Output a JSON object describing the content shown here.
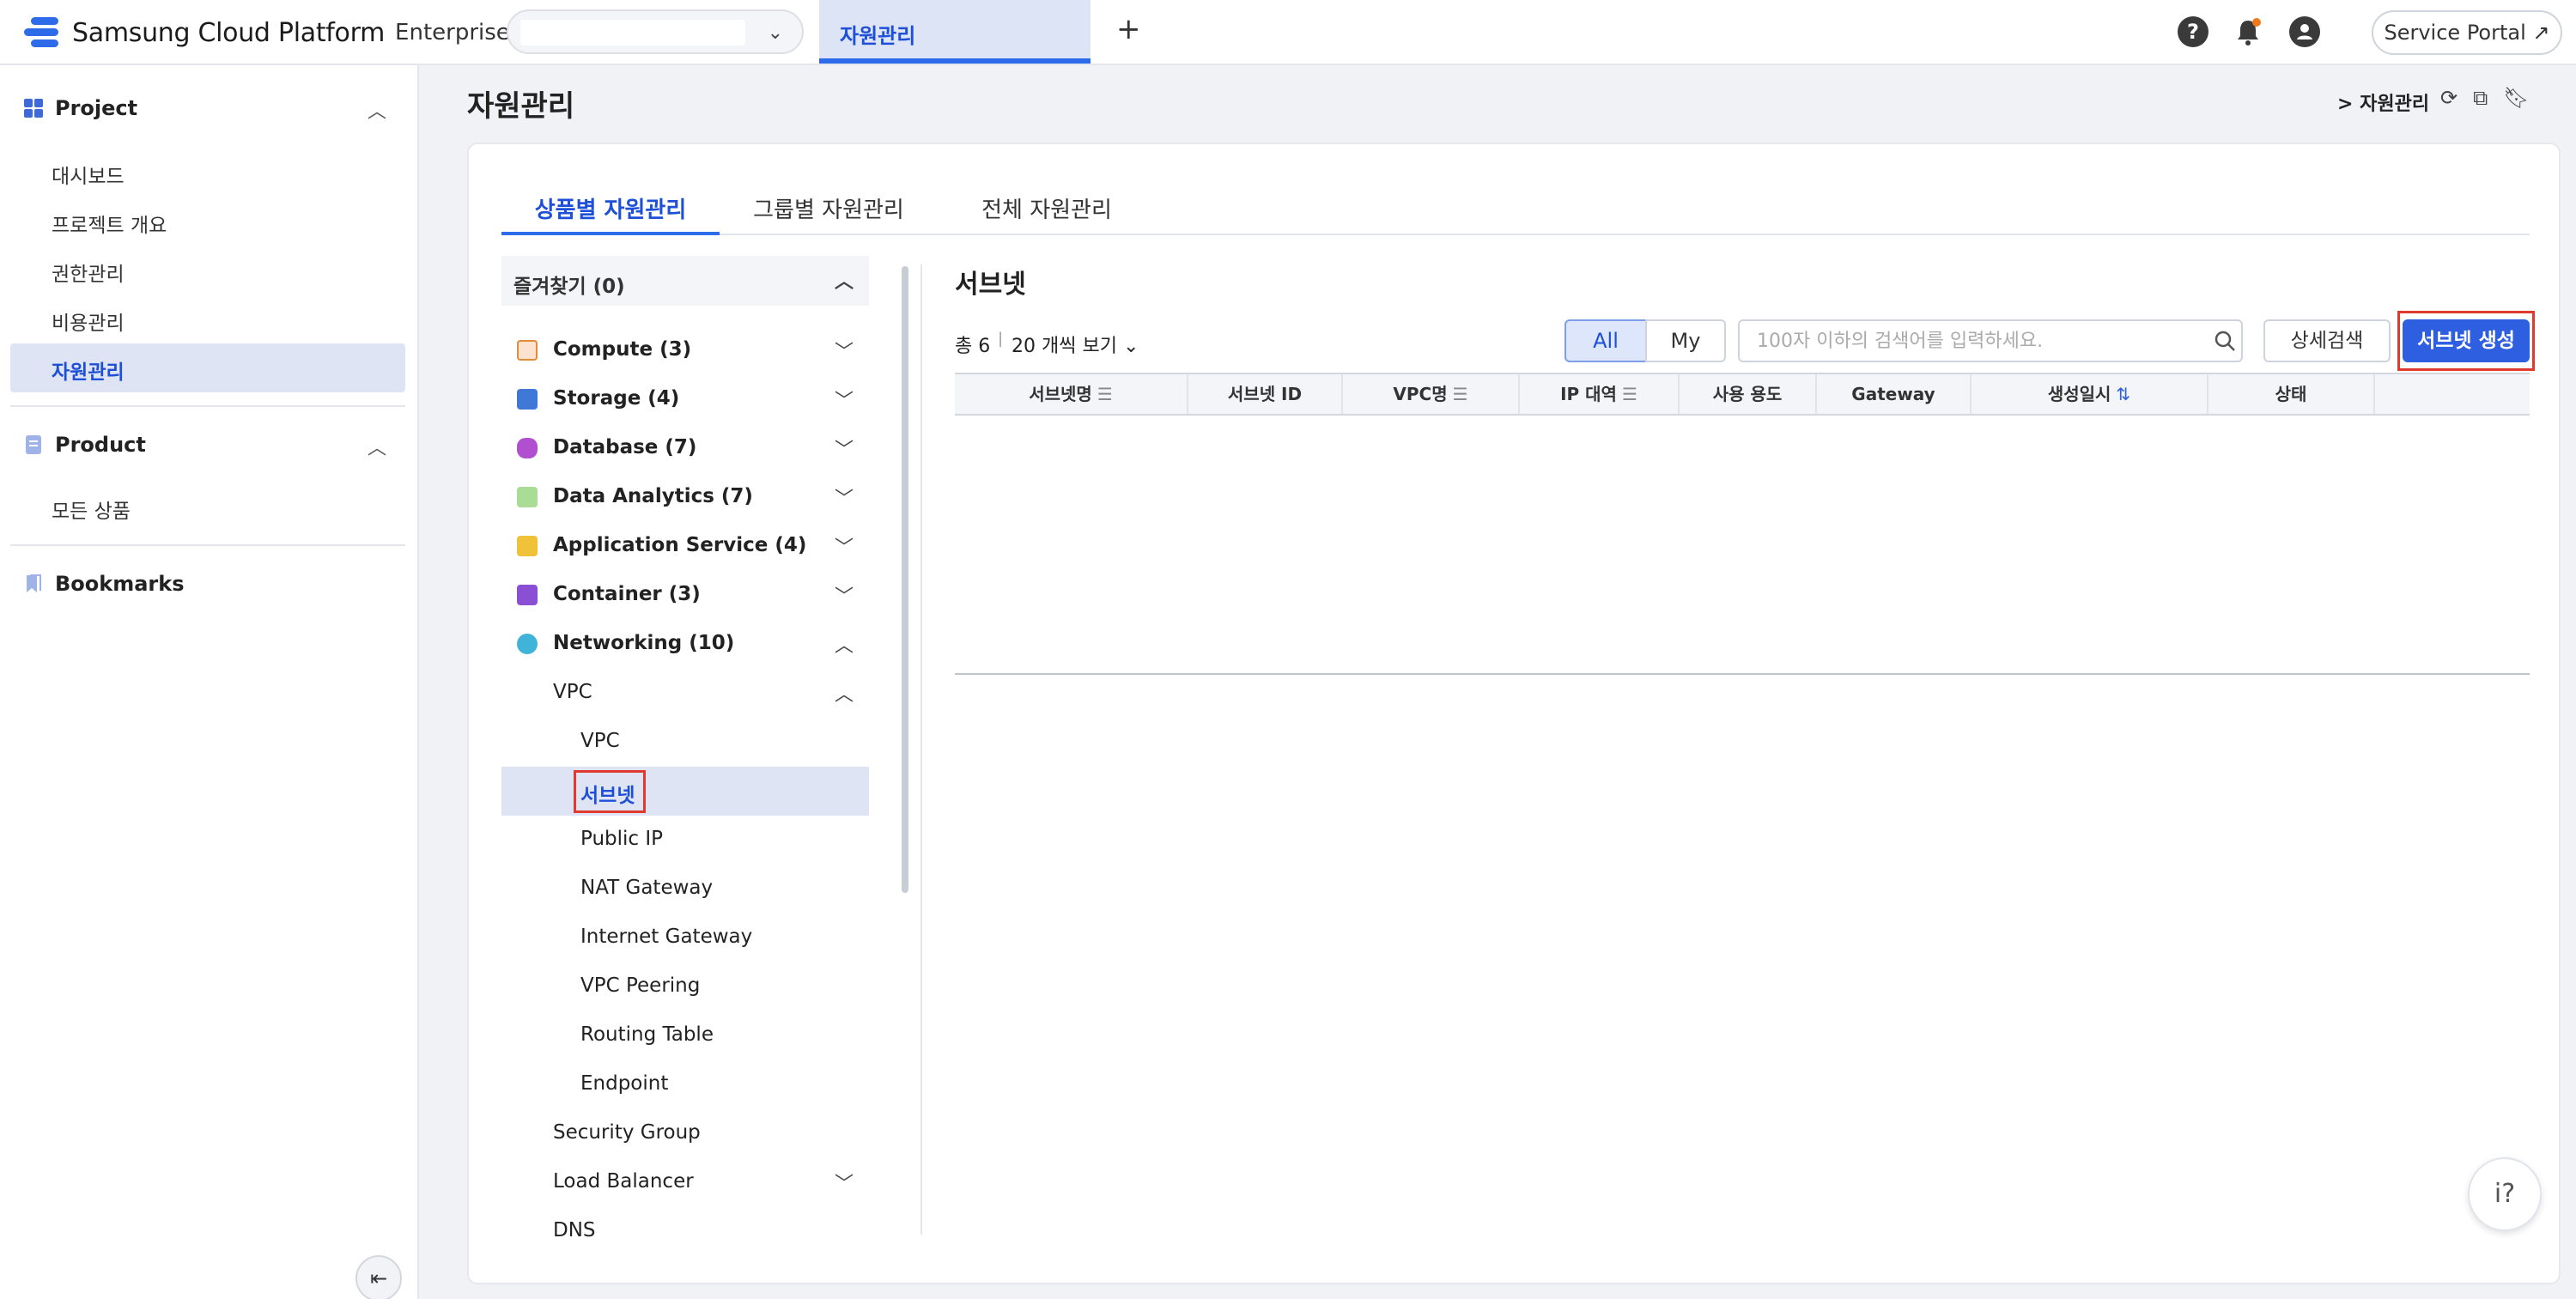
{
  "header": {
    "brand": "Samsung Cloud Platform",
    "brand_sub": "Enterprise",
    "active_tab": "자원관리",
    "add_tab_symbol": "+",
    "help_symbol": "?",
    "service_portal": "Service Portal ↗"
  },
  "sidebar": {
    "project_label": "Project",
    "project_items": [
      "대시보드",
      "프로젝트 개요",
      "권한관리",
      "비용관리",
      "자원관리"
    ],
    "product_label": "Product",
    "product_items": [
      "모든 상품"
    ],
    "bookmarks_label": "Bookmarks",
    "active_item": "자원관리"
  },
  "page": {
    "title": "자원관리",
    "breadcrumb": "> 자원관리"
  },
  "tabs": [
    "상품별 자원관리",
    "그룹별 자원관리",
    "전체 자원관리"
  ],
  "tree": {
    "favorites": "즐겨찾기 (0)",
    "categories": [
      {
        "label": "Compute (3)",
        "color": "#e58a3c"
      },
      {
        "label": "Storage (4)",
        "color": "#3f78d6"
      },
      {
        "label": "Database (7)",
        "color": "#b04fd0"
      },
      {
        "label": "Data Analytics (7)",
        "color": "#7cc36a"
      },
      {
        "label": "Application Service (4)",
        "color": "#f0c23a"
      },
      {
        "label": "Container (3)",
        "color": "#8b4fd6"
      },
      {
        "label": "Networking (10)",
        "color": "#3fb4d8"
      }
    ],
    "vpc_group": "VPC",
    "vpc_items": [
      "VPC",
      "서브넷",
      "Public IP",
      "NAT Gateway",
      "Internet Gateway",
      "VPC Peering",
      "Routing Table",
      "Endpoint"
    ],
    "security_group": "Security Group",
    "load_balancer": "Load Balancer",
    "dns_partial": "DNS",
    "selected": "서브넷"
  },
  "panel": {
    "title": "서브넷",
    "total_label": "총 6",
    "per_page": "20 개씩 보기",
    "toggle_all": "All",
    "toggle_my": "My",
    "search_placeholder": "100자 이하의 검색어를 입력하세요.",
    "detail_search": "상세검색",
    "create_button": "서브넷 생성"
  },
  "table": {
    "columns": [
      "서브넷명",
      "서브넷 ID",
      "VPC명",
      "IP 대역",
      "사용 용도",
      "Gateway",
      "생성일시",
      "상태"
    ],
    "rows": []
  },
  "colors": {
    "accent": "#2d6bea",
    "highlight": "#e03a30"
  }
}
